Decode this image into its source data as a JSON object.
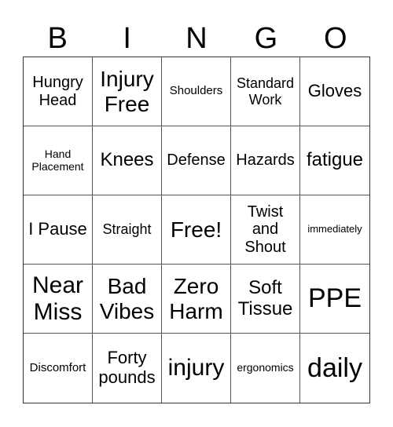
{
  "header": [
    "B",
    "I",
    "N",
    "G",
    "O"
  ],
  "cells": [
    "Hungry Head",
    "Injury Free",
    "Shoulders",
    "Standard Work",
    "Gloves",
    "Hand Placement",
    "Knees",
    "Defense",
    "Hazards",
    "fatigue",
    "I Pause",
    "Straight",
    "Free!",
    "Twist and Shout",
    "immediately",
    "Near Miss",
    "Bad Vibes",
    "Zero Harm",
    "Soft Tissue",
    "PPE",
    "Discomfort",
    "Forty pounds",
    "injury",
    "ergonomics",
    "daily"
  ]
}
